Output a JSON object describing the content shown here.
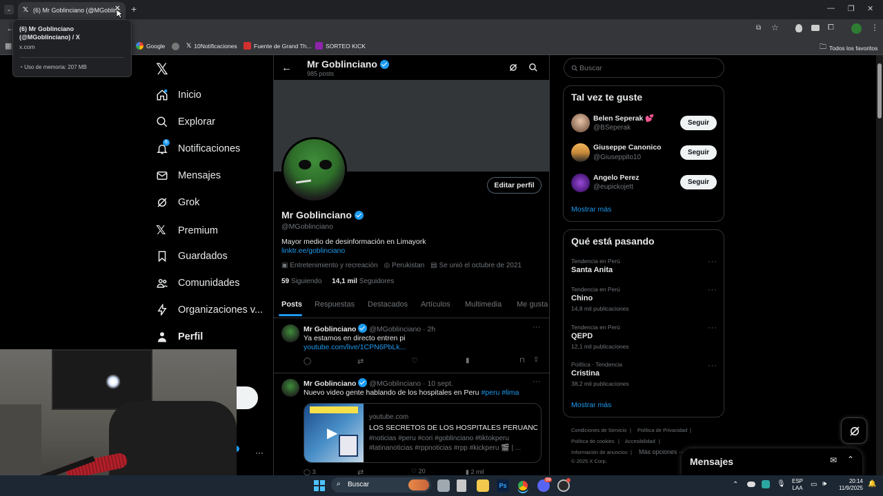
{
  "browser": {
    "tab_title": "(6) Mr Goblinciano (@MGoblinc",
    "tooltip_title": "(6) Mr Goblinciano (@MGoblinciano) / X",
    "tooltip_domain": "x.com",
    "tooltip_memory": "Uso de memoria: 207 MB",
    "bookmarks": [
      "Google",
      "10Notificaciones",
      "Fuente de Grand Th...",
      "SORTEO KICK"
    ],
    "all_bookmarks": "Todos los favoritos"
  },
  "nav": {
    "items": [
      "Inicio",
      "Explorar",
      "Notificaciones",
      "Mensajes",
      "Grok",
      "Premium",
      "Guardados",
      "Comunidades",
      "Organizaciones v...",
      "Perfil"
    ],
    "notif_count": "6"
  },
  "profile": {
    "header_name": "Mr Goblinciano",
    "post_count": "985 posts",
    "name": "Mr Goblinciano",
    "handle": "@MGoblinciano",
    "bio": "Mayor medio de desinformación en Limayork",
    "link": "linktr.ee/goblinciano",
    "category": "Entretenimiento y recreación",
    "location": "Perukistan",
    "joined": "Se unió el octubre de 2021",
    "following_count": "59",
    "following_label": "Siguiendo",
    "followers_count": "14,1 mil",
    "followers_label": "Seguidores",
    "edit_button": "Editar perfil",
    "tabs": [
      "Posts",
      "Respuestas",
      "Destacados",
      "Artículos",
      "Multimedia",
      "Me gusta"
    ]
  },
  "posts": [
    {
      "name": "Mr Goblinciano",
      "handle": "@MGoblinciano",
      "time": "· 2h",
      "text": "Ya estamos en directo entren pi",
      "link": "youtube.com/live/1CPN6PbLk..."
    },
    {
      "name": "Mr Goblinciano",
      "handle": "@MGoblinciano",
      "time": "· 10 sept.",
      "text": "Nuevo video gente hablando de los hospitales en Peru",
      "hashtags": "#peru #lima",
      "card_domain": "youtube.com",
      "card_title": "LOS SECRETOS DE LOS HOSPITALES PERUANOS ...",
      "card_tags": "#noticias #peru #cori #goblinciano #tiktokperu #latinanoticias #rppnoticias #rpp #kickperu 🎬 | ...",
      "reply_count": "3",
      "like_count": "20",
      "views_count": "2 mil"
    }
  ],
  "search": {
    "placeholder": "Buscar"
  },
  "suggestions": {
    "title": "Tal vez te guste",
    "users": [
      {
        "name": "Belen Seperak 💕",
        "handle": "@BSeperak"
      },
      {
        "name": "Giuseppe Canonico",
        "handle": "@Giuseppito10"
      },
      {
        "name": "Angelo Perez",
        "handle": "@eupickojett"
      }
    ],
    "follow_label": "Seguir",
    "more": "Mostrar más"
  },
  "trends": {
    "title": "Qué está pasando",
    "items": [
      {
        "meta": "Tendencia en Perú",
        "name": "Santa Anita",
        "count": ""
      },
      {
        "meta": "Tendencia en Perú",
        "name": "Chino",
        "count": "14,8 mil publicaciones"
      },
      {
        "meta": "Tendencia en Perú",
        "name": "QEPD",
        "count": "12,1 mil publicaciones"
      },
      {
        "meta": "Política · Tendencia",
        "name": "Cristina",
        "count": "38,2 mil publicaciones"
      }
    ],
    "more": "Mostrar más"
  },
  "footer": {
    "links": [
      "Condiciones de Servicio",
      "Política de Privacidad",
      "Política de cookies",
      "Accesibilidad",
      "Información de anuncios",
      "Más opciones ···"
    ],
    "copyright": "© 2025 X Corp."
  },
  "messages_drawer": {
    "title": "Mensajes"
  },
  "taskbar": {
    "search": "Buscar",
    "lang": "ESP",
    "lang2": "LAA",
    "time": "20:14",
    "date": "11/9/2025",
    "discord_badge": "99"
  },
  "colors": {
    "accent": "#1d9bf0",
    "bg": "#000000"
  }
}
